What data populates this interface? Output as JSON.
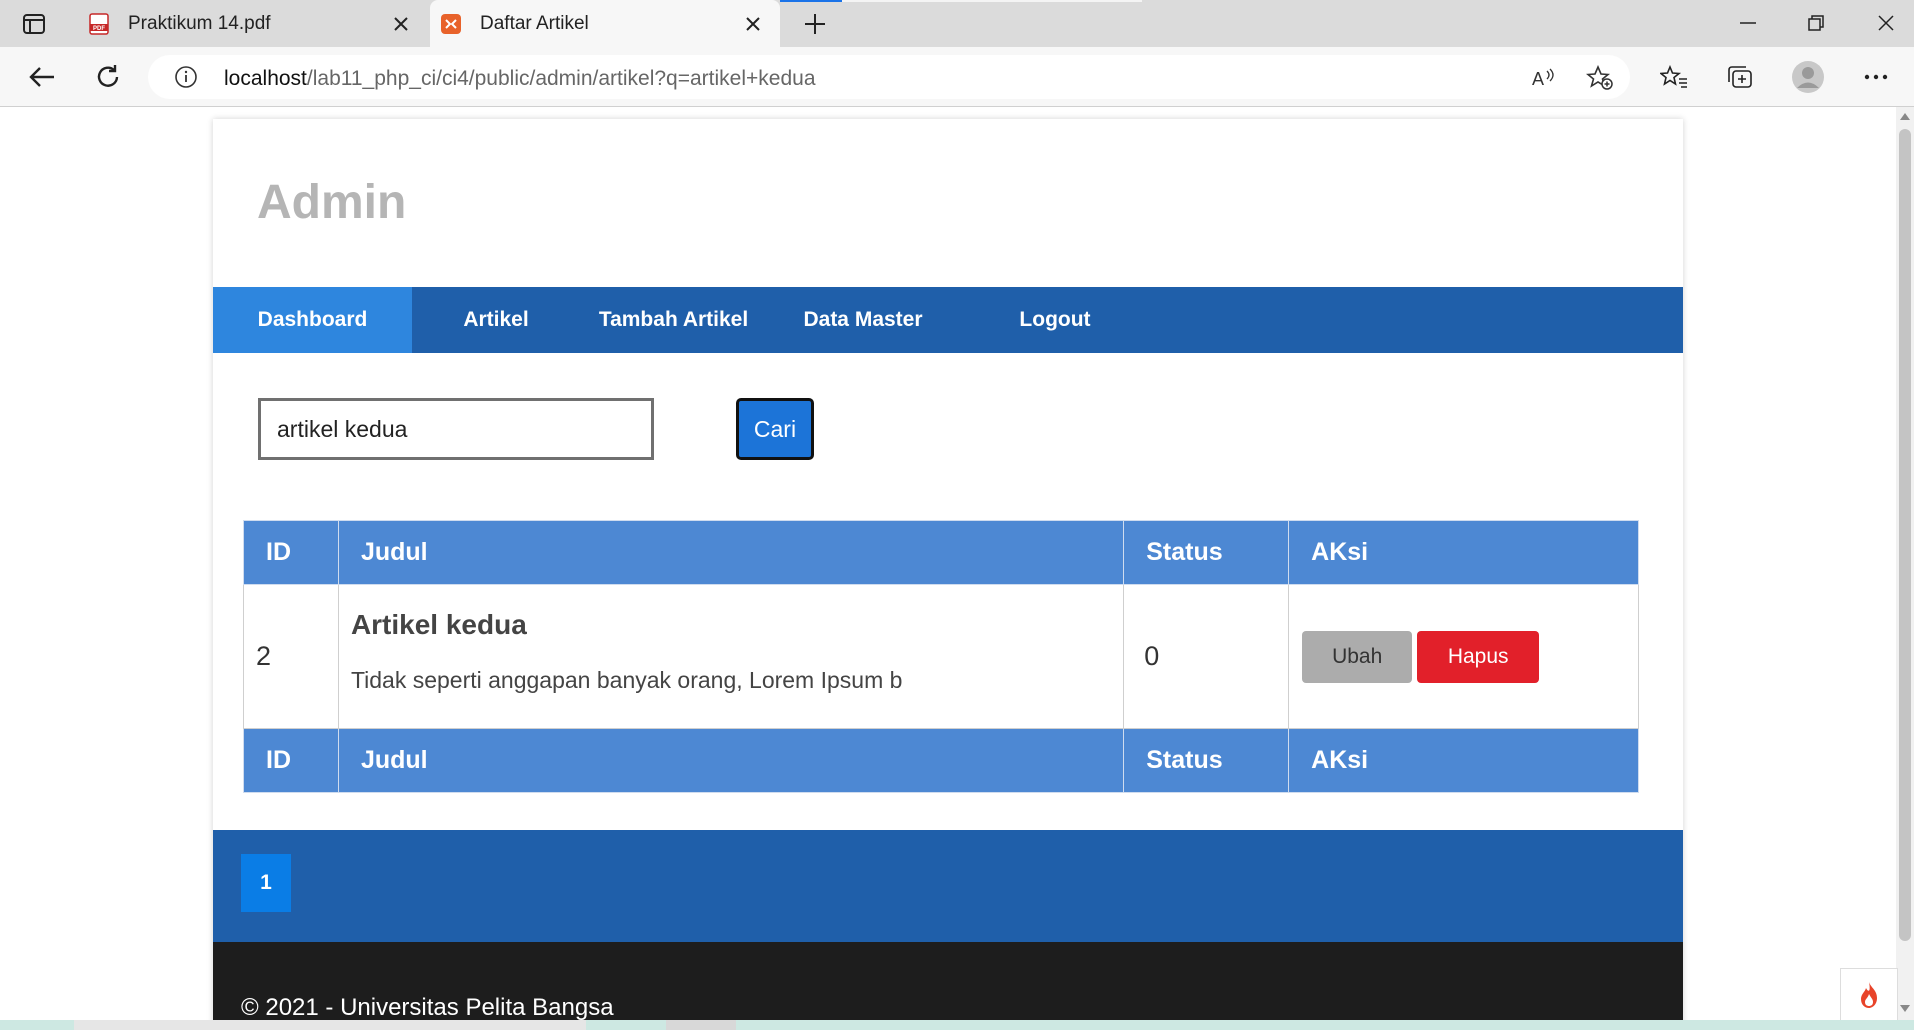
{
  "browser": {
    "tabs": [
      {
        "title": "Praktikum 14.pdf",
        "icon": "pdf-icon",
        "active": false
      },
      {
        "title": "Daftar Artikel",
        "icon": "codeigniter-icon",
        "active": true
      }
    ],
    "url_host": "localhost",
    "url_rest": "/lab11_php_ci/ci4/public/admin/artikel?q=artikel+kedua",
    "accent_color": "#1a73e8"
  },
  "page": {
    "header": {
      "title": "Admin"
    },
    "nav": {
      "items": [
        {
          "label": "Dashboard",
          "active": true
        },
        {
          "label": "Artikel",
          "active": false
        },
        {
          "label": "Tambah Artikel",
          "active": false
        },
        {
          "label": "Data Master",
          "active": false
        },
        {
          "label": "Logout",
          "active": false
        }
      ],
      "bg_color": "#1f5faa",
      "active_color": "#2e86de"
    },
    "search": {
      "value": "artikel kedua",
      "button_label": "Cari"
    },
    "table": {
      "columns": [
        "ID",
        "Judul",
        "Status",
        "AKsi"
      ],
      "rows": [
        {
          "id": "2",
          "title": "Artikel kedua",
          "excerpt": "Tidak seperti anggapan banyak orang, Lorem Ipsum b",
          "status": "0",
          "actions": {
            "edit": "Ubah",
            "delete": "Hapus"
          }
        }
      ],
      "footer_columns": [
        "ID",
        "Judul",
        "Status",
        "AKsi"
      ],
      "header_color": "#4d88d3"
    },
    "pagination": {
      "current": "1"
    },
    "footer": {
      "text": "© 2021 - Universitas Pelita Bangsa"
    }
  }
}
